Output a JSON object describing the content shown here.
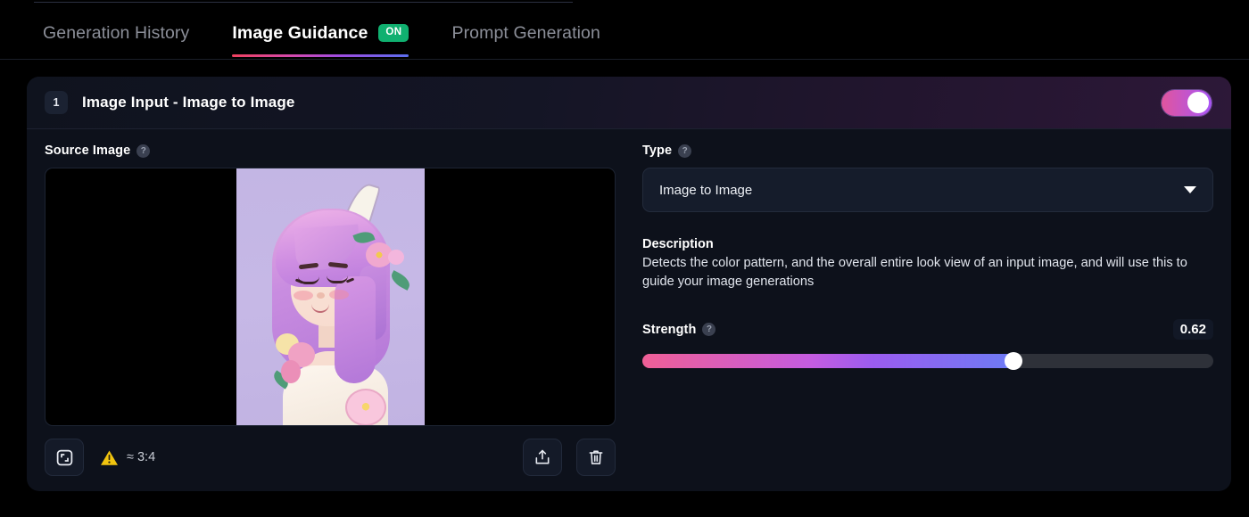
{
  "tabs": [
    {
      "label": "Generation History",
      "active": false,
      "badge": null
    },
    {
      "label": "Image Guidance",
      "active": true,
      "badge": "ON"
    },
    {
      "label": "Prompt Generation",
      "active": false,
      "badge": null
    }
  ],
  "card": {
    "step_number": "1",
    "title": "Image Input - Image to Image",
    "enabled_toggle": "on"
  },
  "source_image": {
    "label": "Source Image",
    "help": "?",
    "aspect_ratio_text": "≈ 3:4",
    "warning_icon": "warning-triangle",
    "crop_icon": "crop-icon",
    "upload_icon": "upload-icon",
    "delete_icon": "trash-icon"
  },
  "type_field": {
    "label": "Type",
    "help": "?",
    "value": "Image to Image",
    "options": [
      "Image to Image"
    ]
  },
  "description": {
    "title": "Description",
    "text": "Detects the color pattern, and the overall entire look view of an input image, and will use this to guide your image generations"
  },
  "strength": {
    "label": "Strength",
    "help": "?",
    "value": "0.62",
    "percent": 65
  },
  "colors": {
    "accent_green": "#10b070",
    "gradient_start": "#ef5f96",
    "gradient_mid": "#a855f7",
    "gradient_end": "#6d7bf5",
    "card_bg": "#0d111b",
    "page_bg": "#000000",
    "warning": "#f0c020"
  }
}
